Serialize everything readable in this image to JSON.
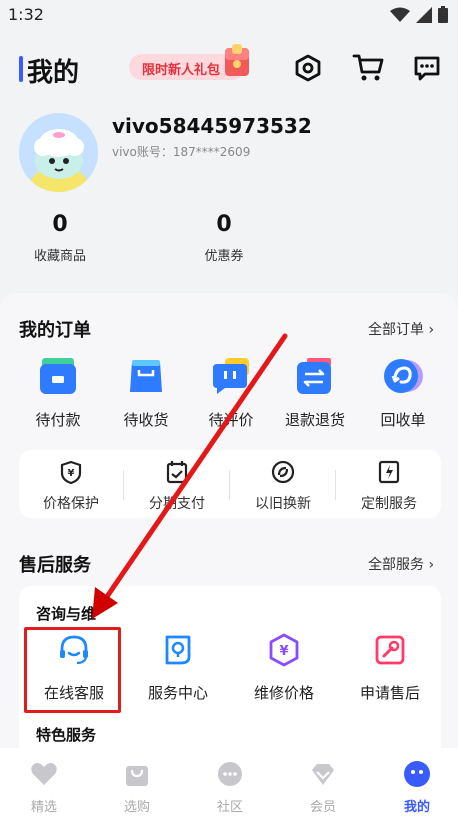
{
  "status_bar": {
    "time": "1:32"
  },
  "header": {
    "title": "我的",
    "promo": "限时新人礼包"
  },
  "profile": {
    "username": "vivo58445973532",
    "account": "vivo账号：187****2609"
  },
  "stats": [
    {
      "value": "0",
      "label": "收藏商品"
    },
    {
      "value": "0",
      "label": "优惠券"
    }
  ],
  "orders": {
    "title": "我的订单",
    "all_link": "全部订单 ›",
    "items": [
      {
        "label": "待付款",
        "icon": "wallet-icon"
      },
      {
        "label": "待收货",
        "icon": "package-icon"
      },
      {
        "label": "待评价",
        "icon": "review-icon"
      },
      {
        "label": "退款退货",
        "icon": "refund-icon"
      },
      {
        "label": "回收单",
        "icon": "recycle-icon"
      }
    ]
  },
  "services": [
    {
      "label": "价格保护",
      "icon": "price-protect-icon"
    },
    {
      "label": "分期支付",
      "icon": "installment-icon"
    },
    {
      "label": "以旧换新",
      "icon": "trade-in-icon"
    },
    {
      "label": "定制服务",
      "icon": "custom-service-icon"
    }
  ],
  "after_sales": {
    "title": "售后服务",
    "all_link": "全部服务 ›",
    "consult_title": "咨询与维",
    "items": [
      {
        "label": "在线客服",
        "icon": "headset-icon"
      },
      {
        "label": "服务中心",
        "icon": "service-center-icon"
      },
      {
        "label": "维修价格",
        "icon": "repair-price-icon"
      },
      {
        "label": "申请售后",
        "icon": "wrench-icon"
      }
    ],
    "special_title": "特色服务"
  },
  "bottom_nav": [
    {
      "label": "精选",
      "icon": "heart-icon"
    },
    {
      "label": "选购",
      "icon": "bag-icon"
    },
    {
      "label": "社区",
      "icon": "chat-bubble-icon"
    },
    {
      "label": "会员",
      "icon": "diamond-icon"
    },
    {
      "label": "我的",
      "icon": "profile-face-icon",
      "active": true
    }
  ],
  "colors": {
    "accent": "#3a5bff",
    "highlight": "#e01c1c"
  }
}
